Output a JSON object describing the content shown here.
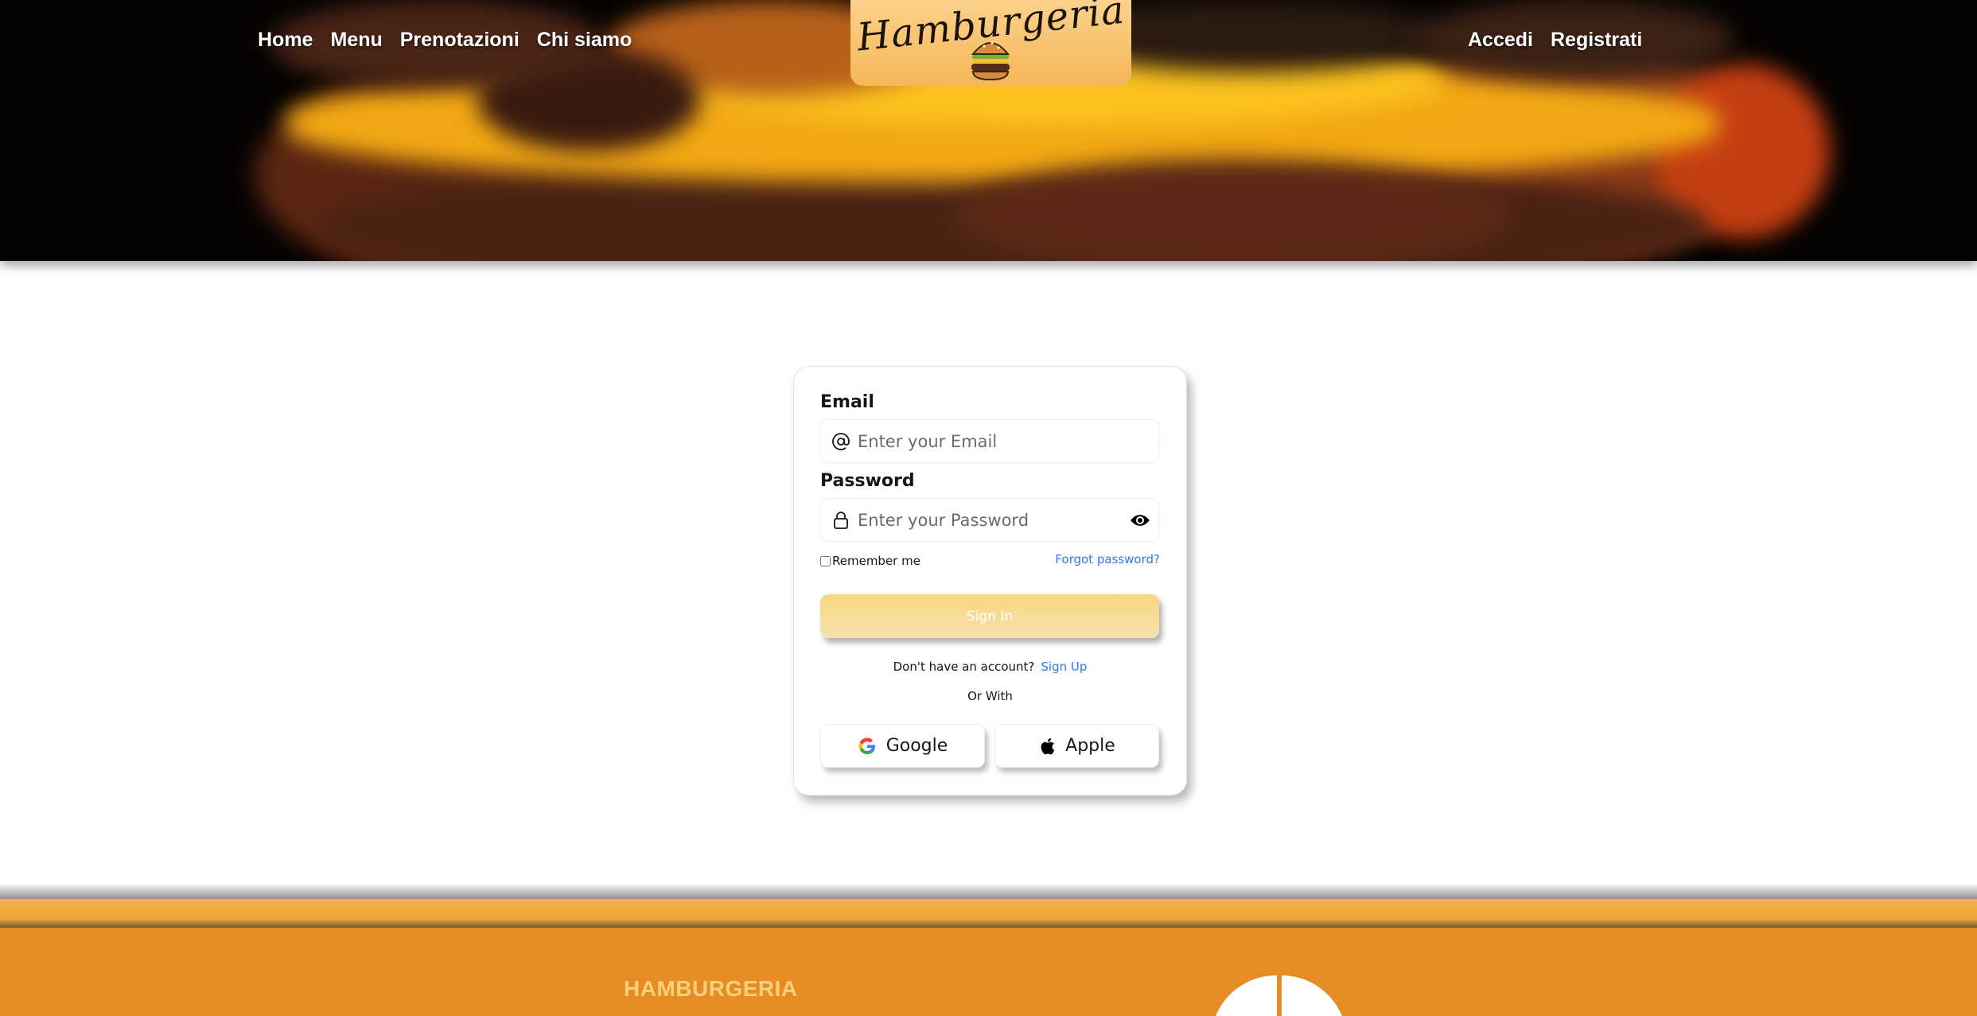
{
  "nav": {
    "left": [
      {
        "label": "Home"
      },
      {
        "label": "Menu"
      },
      {
        "label": "Prenotazioni"
      },
      {
        "label": "Chi siamo"
      }
    ],
    "right": [
      {
        "label": "Accedi"
      },
      {
        "label": "Registrati"
      }
    ]
  },
  "logo": {
    "text": "Hamburgeria",
    "icon": "burger-icon"
  },
  "form": {
    "email_label": "Email",
    "email_placeholder": "Enter your Email",
    "email_value": "",
    "email_icon": "at-icon",
    "password_label": "Password",
    "password_placeholder": "Enter your Password",
    "password_value": "",
    "password_icon": "lock-icon",
    "toggle_icon": "eye-icon",
    "remember_label": "Remember me",
    "remember_checked": false,
    "forgot_label": "Forgot password?",
    "signin_label": "Sign In",
    "no_account_text": "Don't have an account?",
    "signup_label": "Sign Up",
    "or_with": "Or With",
    "google_label": "Google",
    "apple_label": "Apple"
  },
  "footer": {
    "brand": "HAMBURGERIA"
  },
  "colors": {
    "accent_link": "#2d79f3",
    "logo_box": "#f6b657",
    "signin_button": "#f8d67d",
    "footer_band": "#f5b542",
    "footer": "#e68c24",
    "footer_brand": "#fbd07a"
  }
}
